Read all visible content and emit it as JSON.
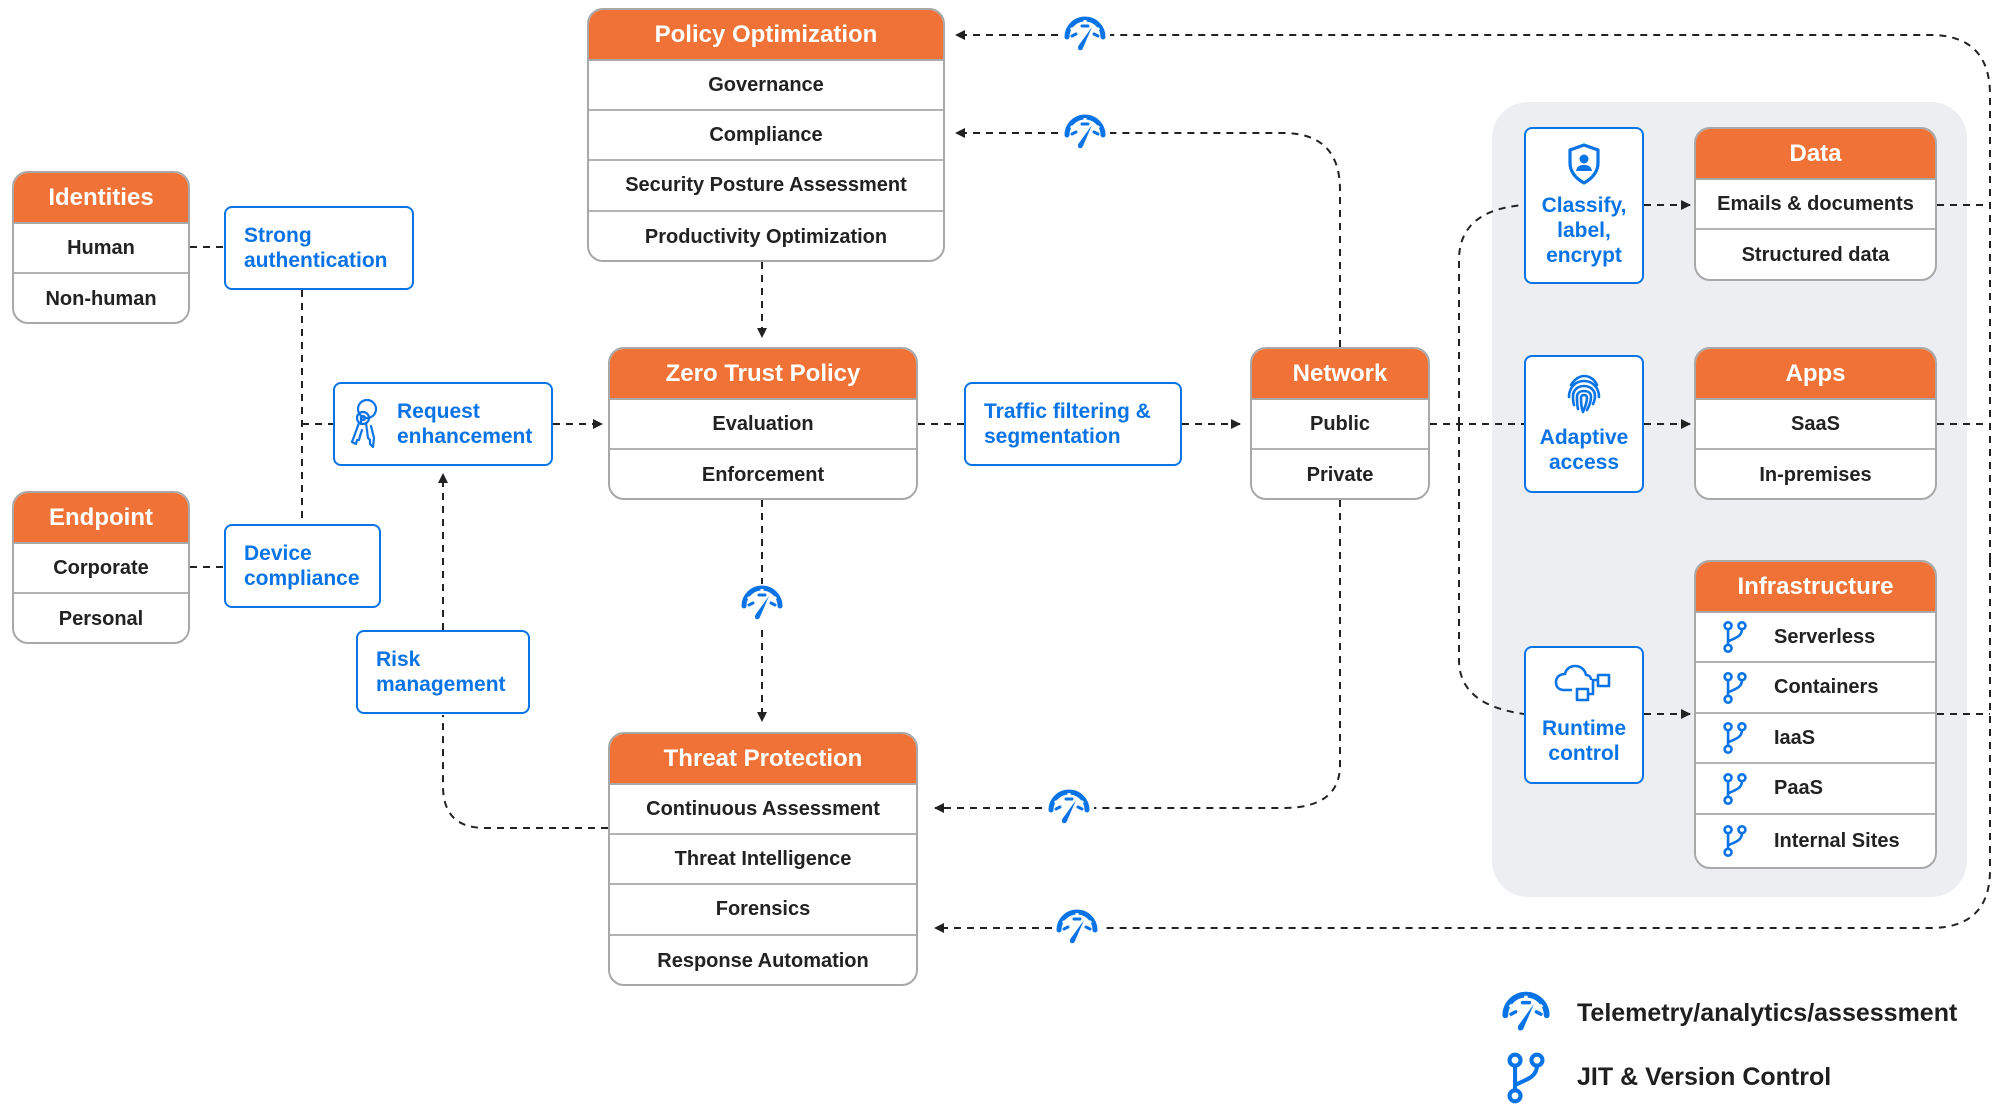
{
  "colors": {
    "accent_orange": "#f07236",
    "accent_blue": "#0a74e6",
    "panel_grey": "#eceef2",
    "connector": "#222222"
  },
  "cards": {
    "identities": {
      "title": "Identities",
      "items": [
        "Human",
        "Non-human"
      ]
    },
    "endpoint": {
      "title": "Endpoint",
      "items": [
        "Corporate",
        "Personal"
      ]
    },
    "policy_optimization": {
      "title": "Policy Optimization",
      "items": [
        "Governance",
        "Compliance",
        "Security Posture Assessment",
        "Productivity Optimization"
      ]
    },
    "zero_trust_policy": {
      "title": "Zero Trust Policy",
      "items": [
        "Evaluation",
        "Enforcement"
      ]
    },
    "threat_protection": {
      "title": "Threat Protection",
      "items": [
        "Continuous Assessment",
        "Threat Intelligence",
        "Forensics",
        "Response Automation"
      ]
    },
    "network": {
      "title": "Network",
      "items": [
        "Public",
        "Private"
      ]
    },
    "data": {
      "title": "Data",
      "items": [
        "Emails & documents",
        "Structured data"
      ]
    },
    "apps": {
      "title": "Apps",
      "items": [
        "SaaS",
        "In-premises"
      ]
    },
    "infrastructure": {
      "title": "Infrastructure",
      "items": [
        "Serverless",
        "Containers",
        "IaaS",
        "PaaS",
        "Internal Sites"
      ],
      "item_icon": "branch-icon"
    }
  },
  "controls": {
    "strong_authentication": {
      "label": "Strong\nauthentication"
    },
    "device_compliance": {
      "label": "Device\ncompliance"
    },
    "request_enhancement": {
      "label": "Request\nenhancement",
      "icon": "keys-icon"
    },
    "risk_management": {
      "label": "Risk\nmanagement"
    },
    "traffic_filtering": {
      "label": "Traffic filtering &\nsegmentation"
    },
    "classify": {
      "label": "Classify,\nlabel,\nencrypt",
      "icon": "shield-user-icon"
    },
    "adaptive_access": {
      "label": "Adaptive\naccess",
      "icon": "fingerprint-icon"
    },
    "runtime_control": {
      "label": "Runtime\ncontrol",
      "icon": "cloud-nodes-icon"
    }
  },
  "legend": [
    {
      "icon": "gauge-icon",
      "label": "Telemetry/analytics/assessment"
    },
    {
      "icon": "branch-icon",
      "label": "JIT & Version Control"
    }
  ]
}
